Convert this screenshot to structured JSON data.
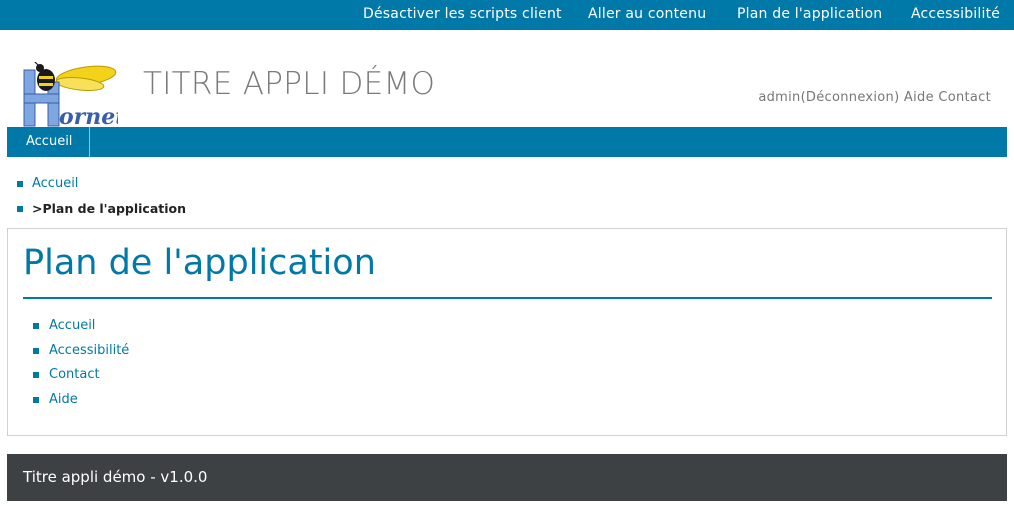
{
  "topbar": {
    "links": [
      {
        "label": "Désactiver les scripts client"
      },
      {
        "label": "Aller au contenu"
      },
      {
        "label": "Plan de l'application"
      },
      {
        "label": "Accessibilité"
      }
    ]
  },
  "header": {
    "logo_text": "Hornet",
    "app_title": "TITRE APPLI DÉMO",
    "user": "admin",
    "logout": "(Déconnexion)",
    "help": "Aide",
    "contact": "Contact"
  },
  "nav": {
    "items": [
      {
        "label": "Accueil"
      }
    ]
  },
  "breadcrumb": {
    "home": "Accueil",
    "separator": ">",
    "current": "Plan de l'application"
  },
  "main": {
    "title": "Plan de l'application",
    "sitemap": [
      {
        "label": "Accueil"
      },
      {
        "label": "Accessibilité"
      },
      {
        "label": "Contact"
      },
      {
        "label": "Aide"
      }
    ]
  },
  "footer": {
    "text": "Titre appli démo - v1.0.0"
  },
  "colors": {
    "brand": "#0079a8",
    "footer_bg": "#3d4143",
    "title_gray": "#7a7a7a"
  }
}
